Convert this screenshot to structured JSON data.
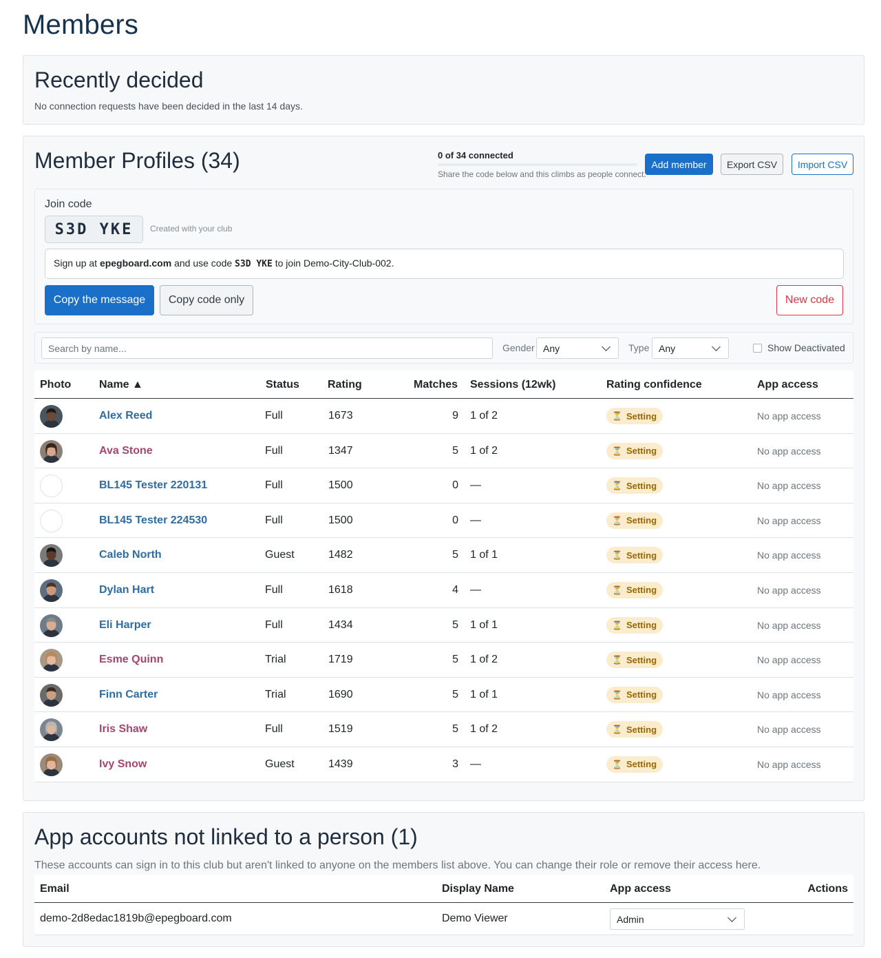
{
  "page": {
    "title": "Members"
  },
  "recent": {
    "title": "Recently decided",
    "text": "No connection requests have been decided in the last 14 days."
  },
  "profiles": {
    "title": "Member Profiles (34)",
    "connected_label": "0 of 34 connected",
    "connected_fraction": 0,
    "connected_hint": "Share the code below and this climbs as people connect.",
    "buttons": {
      "add": "Add member",
      "export": "Export CSV",
      "import": "Import CSV"
    }
  },
  "join": {
    "label": "Join code",
    "code": "S3D YKE",
    "created": "Created with your club",
    "msg_prefix": "Sign up at ",
    "msg_site": "epegboard.com",
    "msg_mid": " and use code ",
    "msg_code": "S3D YKE",
    "msg_suffix": " to join Demo-City-Club-002.",
    "copy_message": "Copy the message",
    "copy_code": "Copy code only",
    "new_code": "New code"
  },
  "filters": {
    "search_placeholder": "Search by name...",
    "gender_label": "Gender",
    "gender_value": "Any",
    "type_label": "Type",
    "type_value": "Any",
    "show_deactivated": "Show Deactivated"
  },
  "table": {
    "headers": {
      "photo": "Photo",
      "name": "Name ▲",
      "status": "Status",
      "rating": "Rating",
      "matches": "Matches",
      "sessions": "Sessions (12wk)",
      "confidence": "Rating confidence",
      "app_access": "App access"
    },
    "rows": [
      {
        "name": "Alex Reed",
        "gender": "m",
        "photo": "photo",
        "status": "Full",
        "rating": "1673",
        "matches": "9",
        "sessions": "1 of 2",
        "confidence": "Setting",
        "app": "No app access",
        "skin": "#6b4a3a",
        "hair": "#1d1a18",
        "bg": "#4a5560"
      },
      {
        "name": "Ava Stone",
        "gender": "f",
        "photo": "photo",
        "status": "Full",
        "rating": "1347",
        "matches": "5",
        "sessions": "1 of 2",
        "confidence": "Setting",
        "app": "No app access",
        "skin": "#d9a78e",
        "hair": "#3b2418",
        "bg": "#8a8078"
      },
      {
        "name": "BL145 Tester 220131",
        "gender": "m",
        "photo": "none",
        "status": "Full",
        "rating": "1500",
        "matches": "0",
        "sessions": "—",
        "confidence": "Setting",
        "app": "No app access",
        "skin": "",
        "hair": "",
        "bg": ""
      },
      {
        "name": "BL145 Tester 224530",
        "gender": "m",
        "photo": "none",
        "status": "Full",
        "rating": "1500",
        "matches": "0",
        "sessions": "—",
        "confidence": "Setting",
        "app": "No app access",
        "skin": "",
        "hair": "",
        "bg": ""
      },
      {
        "name": "Caleb North",
        "gender": "m",
        "photo": "photo",
        "status": "Guest",
        "rating": "1482",
        "matches": "5",
        "sessions": "1 of 1",
        "confidence": "Setting",
        "app": "No app access",
        "skin": "#5a3b2c",
        "hair": "#151210",
        "bg": "#7a7a7a"
      },
      {
        "name": "Dylan Hart",
        "gender": "m",
        "photo": "photo",
        "status": "Full",
        "rating": "1618",
        "matches": "4",
        "sessions": "—",
        "confidence": "Setting",
        "app": "No app access",
        "skin": "#c99a7e",
        "hair": "#4a3426",
        "bg": "#5d6e80"
      },
      {
        "name": "Eli Harper",
        "gender": "m",
        "photo": "photo",
        "status": "Full",
        "rating": "1434",
        "matches": "5",
        "sessions": "1 of 1",
        "confidence": "Setting",
        "app": "No app access",
        "skin": "#d7ad94",
        "hair": "#8a8a88",
        "bg": "#6e7c8a"
      },
      {
        "name": "Esme Quinn",
        "gender": "f",
        "photo": "photo",
        "status": "Trial",
        "rating": "1719",
        "matches": "5",
        "sessions": "1 of 2",
        "confidence": "Setting",
        "app": "No app access",
        "skin": "#e3b9a0",
        "hair": "#b88a5a",
        "bg": "#a89888"
      },
      {
        "name": "Finn Carter",
        "gender": "m",
        "photo": "photo",
        "status": "Trial",
        "rating": "1690",
        "matches": "5",
        "sessions": "1 of 1",
        "confidence": "Setting",
        "app": "No app access",
        "skin": "#caa084",
        "hair": "#3a2a20",
        "bg": "#6a6a6a"
      },
      {
        "name": "Iris Shaw",
        "gender": "f",
        "photo": "photo",
        "status": "Full",
        "rating": "1519",
        "matches": "5",
        "sessions": "1 of 2",
        "confidence": "Setting",
        "app": "No app access",
        "skin": "#dcb7a0",
        "hair": "#b8b6b2",
        "bg": "#7c8690"
      },
      {
        "name": "Ivy Snow",
        "gender": "f",
        "photo": "photo",
        "status": "Guest",
        "rating": "1439",
        "matches": "3",
        "sessions": "—",
        "confidence": "Setting",
        "app": "No app access",
        "skin": "#e1b69a",
        "hair": "#9a6c42",
        "bg": "#9a8a7a"
      }
    ]
  },
  "unlinked": {
    "title": "App accounts not linked to a person (1)",
    "text": "These accounts can sign in to this club but aren't linked to anyone on the members list above. You can change their role or remove their access here.",
    "headers": {
      "email": "Email",
      "display_name": "Display Name",
      "app_access": "App access",
      "actions": "Actions"
    },
    "rows": [
      {
        "email": "demo-2d8edac1819b@epegboard.com",
        "display_name": "Demo Viewer",
        "access": "Admin"
      }
    ]
  },
  "colors": {
    "accent": "#1a6fc9",
    "danger": "#dc3545",
    "male_name": "#2e6da4",
    "female_name": "#a5466f",
    "badge_bg": "#fbeccd",
    "badge_text": "#9a6700"
  }
}
